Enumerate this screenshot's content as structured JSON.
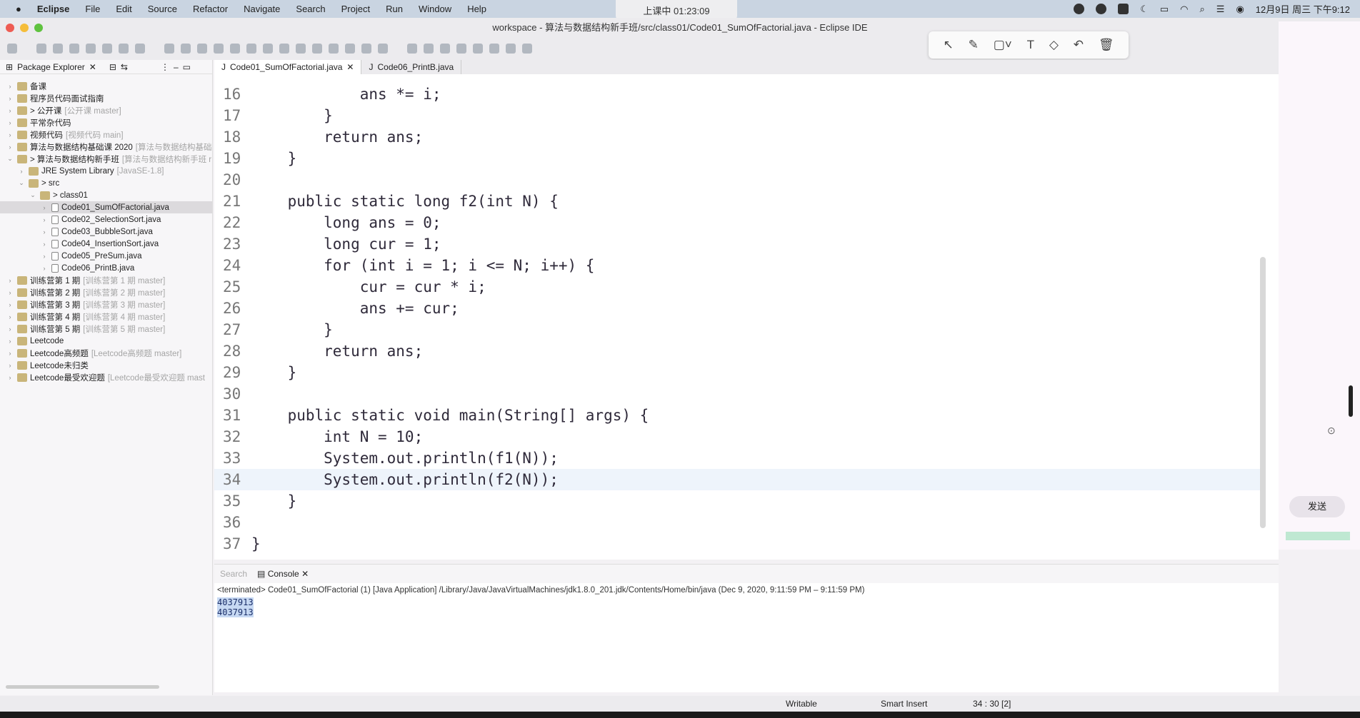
{
  "menubar": {
    "apple": "",
    "app": "Eclipse",
    "items": [
      "File",
      "Edit",
      "Source",
      "Refactor",
      "Navigate",
      "Search",
      "Project",
      "Run",
      "Window",
      "Help"
    ],
    "recording": "上课中 01:23:09",
    "clock": "12月9日 周三 下午9:12"
  },
  "window": {
    "title": "workspace - 算法与数据结构新手班/src/class01/Code01_SumOfFactorial.java - Eclipse IDE"
  },
  "annotation_toolbar": {
    "tools": [
      "↖",
      "✎",
      "▢˅",
      "T",
      "◇",
      "↶",
      "🗑"
    ]
  },
  "package_explorer": {
    "title": "Package Explorer",
    "items": [
      {
        "label": "备课",
        "deco": "",
        "level": 0,
        "twisty": "›"
      },
      {
        "label": "程序员代码面试指南",
        "deco": "",
        "level": 0,
        "twisty": "›"
      },
      {
        "label": "> 公开课",
        "deco": "[公开课 master]",
        "level": 0,
        "twisty": "›"
      },
      {
        "label": "平常杂代码",
        "deco": "",
        "level": 0,
        "twisty": "›"
      },
      {
        "label": "视频代码",
        "deco": "[视频代码 main]",
        "level": 0,
        "twisty": "›"
      },
      {
        "label": "算法与数据结构基础课 2020",
        "deco": "[算法与数据结构基础",
        "level": 0,
        "twisty": "›"
      },
      {
        "label": "> 算法与数据结构新手班",
        "deco": "[算法与数据结构新手班 r",
        "level": 0,
        "twisty": "⌄"
      },
      {
        "label": "JRE System Library",
        "deco": "[JavaSE-1.8]",
        "level": 1,
        "twisty": "›"
      },
      {
        "label": "> src",
        "deco": "",
        "level": 1,
        "twisty": "⌄"
      },
      {
        "label": "> class01",
        "deco": "",
        "level": 2,
        "twisty": "⌄"
      },
      {
        "label": "Code01_SumOfFactorial.java",
        "deco": "",
        "level": 3,
        "twisty": "›",
        "selected": true,
        "java": true
      },
      {
        "label": "Code02_SelectionSort.java",
        "deco": "",
        "level": 3,
        "twisty": "›",
        "java": true
      },
      {
        "label": "Code03_BubbleSort.java",
        "deco": "",
        "level": 3,
        "twisty": "›",
        "java": true
      },
      {
        "label": "Code04_InsertionSort.java",
        "deco": "",
        "level": 3,
        "twisty": "›",
        "java": true
      },
      {
        "label": "Code05_PreSum.java",
        "deco": "",
        "level": 3,
        "twisty": "›",
        "java": true
      },
      {
        "label": "Code06_PrintB.java",
        "deco": "",
        "level": 3,
        "twisty": "›",
        "java": true
      },
      {
        "label": "训练营第 1 期",
        "deco": "[训练营第 1 期 master]",
        "level": 0,
        "twisty": "›"
      },
      {
        "label": "训练营第 2 期",
        "deco": "[训练营第 2 期 master]",
        "level": 0,
        "twisty": "›"
      },
      {
        "label": "训练营第 3 期",
        "deco": "[训练营第 3 期 master]",
        "level": 0,
        "twisty": "›"
      },
      {
        "label": "训练营第 4 期",
        "deco": "[训练营第 4 期 master]",
        "level": 0,
        "twisty": "›"
      },
      {
        "label": "训练营第 5 期",
        "deco": "[训练营第 5 期 master]",
        "level": 0,
        "twisty": "›"
      },
      {
        "label": "Leetcode",
        "deco": "",
        "level": 0,
        "twisty": "›"
      },
      {
        "label": "Leetcode高频题",
        "deco": "[Leetcode高频题 master]",
        "level": 0,
        "twisty": "›"
      },
      {
        "label": "Leetcode未归类",
        "deco": "",
        "level": 0,
        "twisty": "›"
      },
      {
        "label": "Leetcode最受欢迎题",
        "deco": "[Leetcode最受欢迎题 mast",
        "level": 0,
        "twisty": "›"
      }
    ]
  },
  "editor": {
    "tabs": [
      {
        "label": "Code01_SumOfFactorial.java",
        "active": true
      },
      {
        "label": "Code06_PrintB.java",
        "active": false
      }
    ],
    "current_line": 34,
    "lines": [
      {
        "n": "16",
        "t": "            ans *= i;"
      },
      {
        "n": "17",
        "t": "        }"
      },
      {
        "n": "18",
        "t": "        return ans;"
      },
      {
        "n": "19",
        "t": "    }"
      },
      {
        "n": "20",
        "t": ""
      },
      {
        "n": "21",
        "t": "    public static long f2(int N) {"
      },
      {
        "n": "22",
        "t": "        long ans = 0;"
      },
      {
        "n": "23",
        "t": "        long cur = 1;"
      },
      {
        "n": "24",
        "t": "        for (int i = 1; i <= N; i++) {"
      },
      {
        "n": "25",
        "t": "            cur = cur * i;"
      },
      {
        "n": "26",
        "t": "            ans += cur;"
      },
      {
        "n": "27",
        "t": "        }"
      },
      {
        "n": "28",
        "t": "        return ans;"
      },
      {
        "n": "29",
        "t": "    }"
      },
      {
        "n": "30",
        "t": ""
      },
      {
        "n": "31",
        "t": "    public static void main(String[] args) {"
      },
      {
        "n": "32",
        "t": "        int N = 10;"
      },
      {
        "n": "33",
        "t": "        System.out.println(f1(N));"
      },
      {
        "n": "34",
        "t": "        System.out.println(f2(N));"
      },
      {
        "n": "35",
        "t": "    }"
      },
      {
        "n": "36",
        "t": ""
      },
      {
        "n": "37",
        "t": "}"
      }
    ]
  },
  "console": {
    "tabs": [
      "Search",
      "Console"
    ],
    "header": "<terminated> Code01_SumOfFactorial (1) [Java Application] /Library/Java/JavaVirtualMachines/jdk1.8.0_201.jdk/Contents/Home/bin/java  (Dec 9, 2020, 9:11:59 PM – 9:11:59 PM)",
    "output": [
      "4037913",
      "4037913"
    ]
  },
  "status": {
    "writable": "Writable",
    "insert": "Smart Insert",
    "position": "34 : 30 [2]"
  },
  "side_panel": {
    "send": "发送"
  }
}
